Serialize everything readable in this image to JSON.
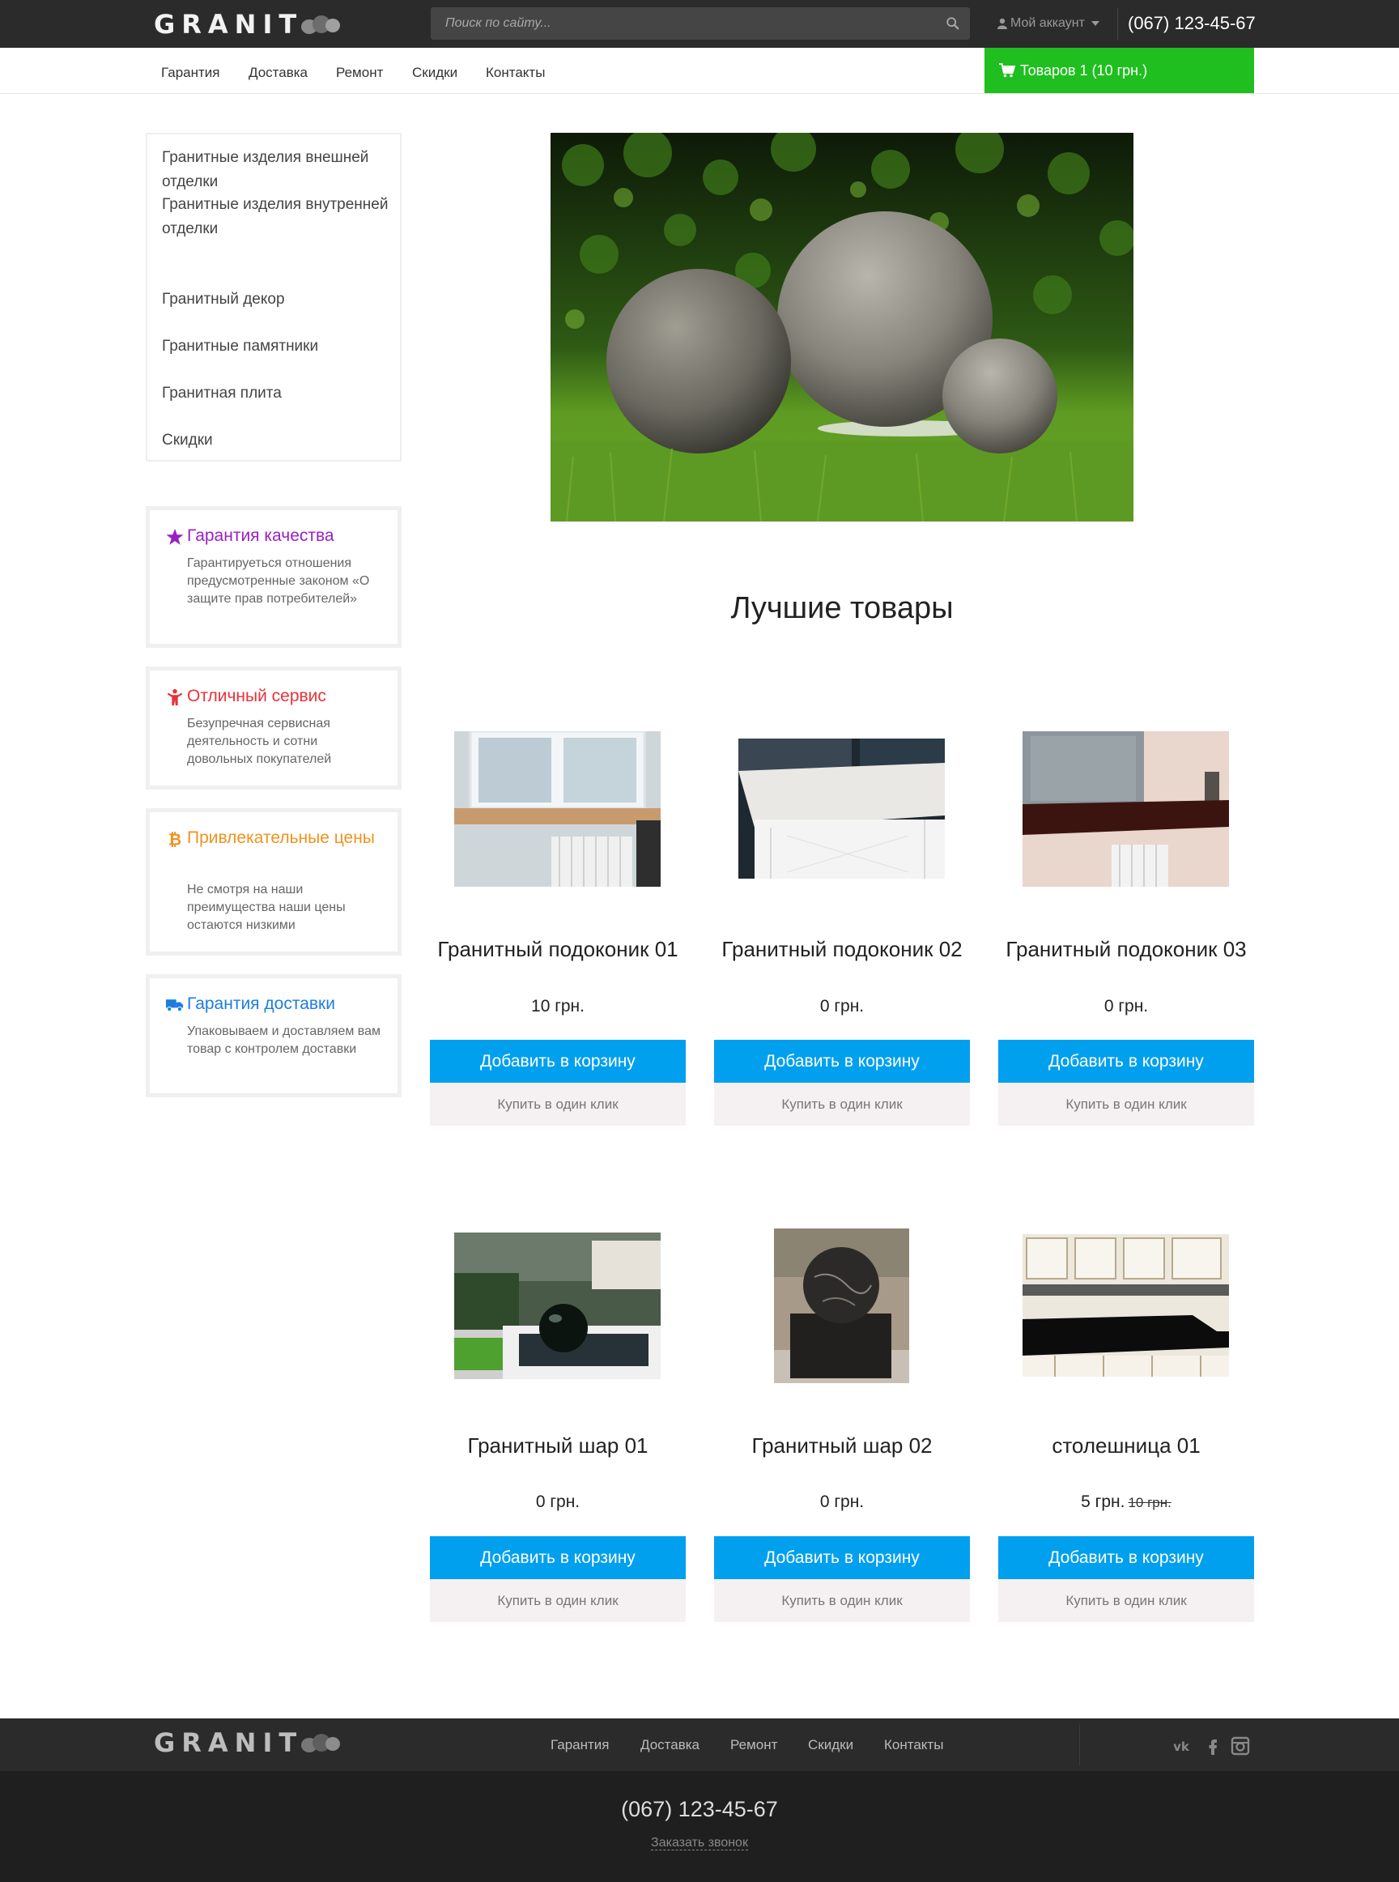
{
  "header": {
    "logo_text": "GRANIT",
    "search_placeholder": "Поиск по сайту...",
    "account_label": "Мой аккаунт",
    "phone": "(067) 123-45-67"
  },
  "nav": {
    "items": [
      "Гарантия",
      "Доставка",
      "Ремонт",
      "Скидки",
      "Контакты"
    ],
    "cart_label": "Товаров 1 (10 грн.)"
  },
  "sidebar": {
    "categories": [
      "Гранитные изделия внешней отделки",
      "Гранитные изделия внутренней отделки",
      "Гранитный декор",
      "Гранитные памятники",
      "Гранитная плита",
      "Скидки"
    ],
    "features": [
      {
        "title": "Гарантия качества",
        "text": "Гарантируеться отношения предусмотренные законом «О защите прав потребителей»",
        "color": "#9b1fc4",
        "icon": "star-icon"
      },
      {
        "title": "Отличный сервис",
        "text": "Безупречная сервисная деятельность и сотни довольных покупателей",
        "color": "#e8323a",
        "icon": "person-icon"
      },
      {
        "title": "Привлекательные цены",
        "text": "Не смотря на наши преимущества наши цены остаются низкими",
        "color": "#f0921e",
        "icon": "bitcoin-icon"
      },
      {
        "title": "Гарантия доставки",
        "text": "Упаковываем и доставляем вам товар с контролем доставки",
        "color": "#1d7de0",
        "icon": "truck-icon"
      }
    ]
  },
  "main": {
    "section_title": "Лучшие товары",
    "add_to_cart_label": "Добавить в корзину",
    "one_click_label": "Купить в один клик",
    "products": [
      {
        "name": "Гранитный подоконик 01",
        "price": "10 грн.",
        "old_price": ""
      },
      {
        "name": "Гранитный подоконик 02",
        "price": "0 грн.",
        "old_price": ""
      },
      {
        "name": "Гранитный подоконик 03",
        "price": "0 грн.",
        "old_price": ""
      },
      {
        "name": "Гранитный шар 01",
        "price": "0 грн.",
        "old_price": ""
      },
      {
        "name": "Гранитный шар 02",
        "price": "0 грн.",
        "old_price": ""
      },
      {
        "name": "столешница 01",
        "price": "5 грн.",
        "old_price": "10 грн."
      }
    ]
  },
  "footer": {
    "logo_text": "GRANIT",
    "nav": [
      "Гарантия",
      "Доставка",
      "Ремонт",
      "Скидки",
      "Контакты"
    ],
    "social": [
      "vk-icon",
      "facebook-icon",
      "instagram-icon"
    ],
    "phone": "(067) 123-45-67",
    "callback_label": "Заказать звонок"
  },
  "colors": {
    "topbar": "#2b2b2b",
    "cart_green": "#1fbf1f",
    "button_blue": "#00a0ee",
    "button_light": "#f5f0f1",
    "footer_dark": "#1f1f1f"
  }
}
